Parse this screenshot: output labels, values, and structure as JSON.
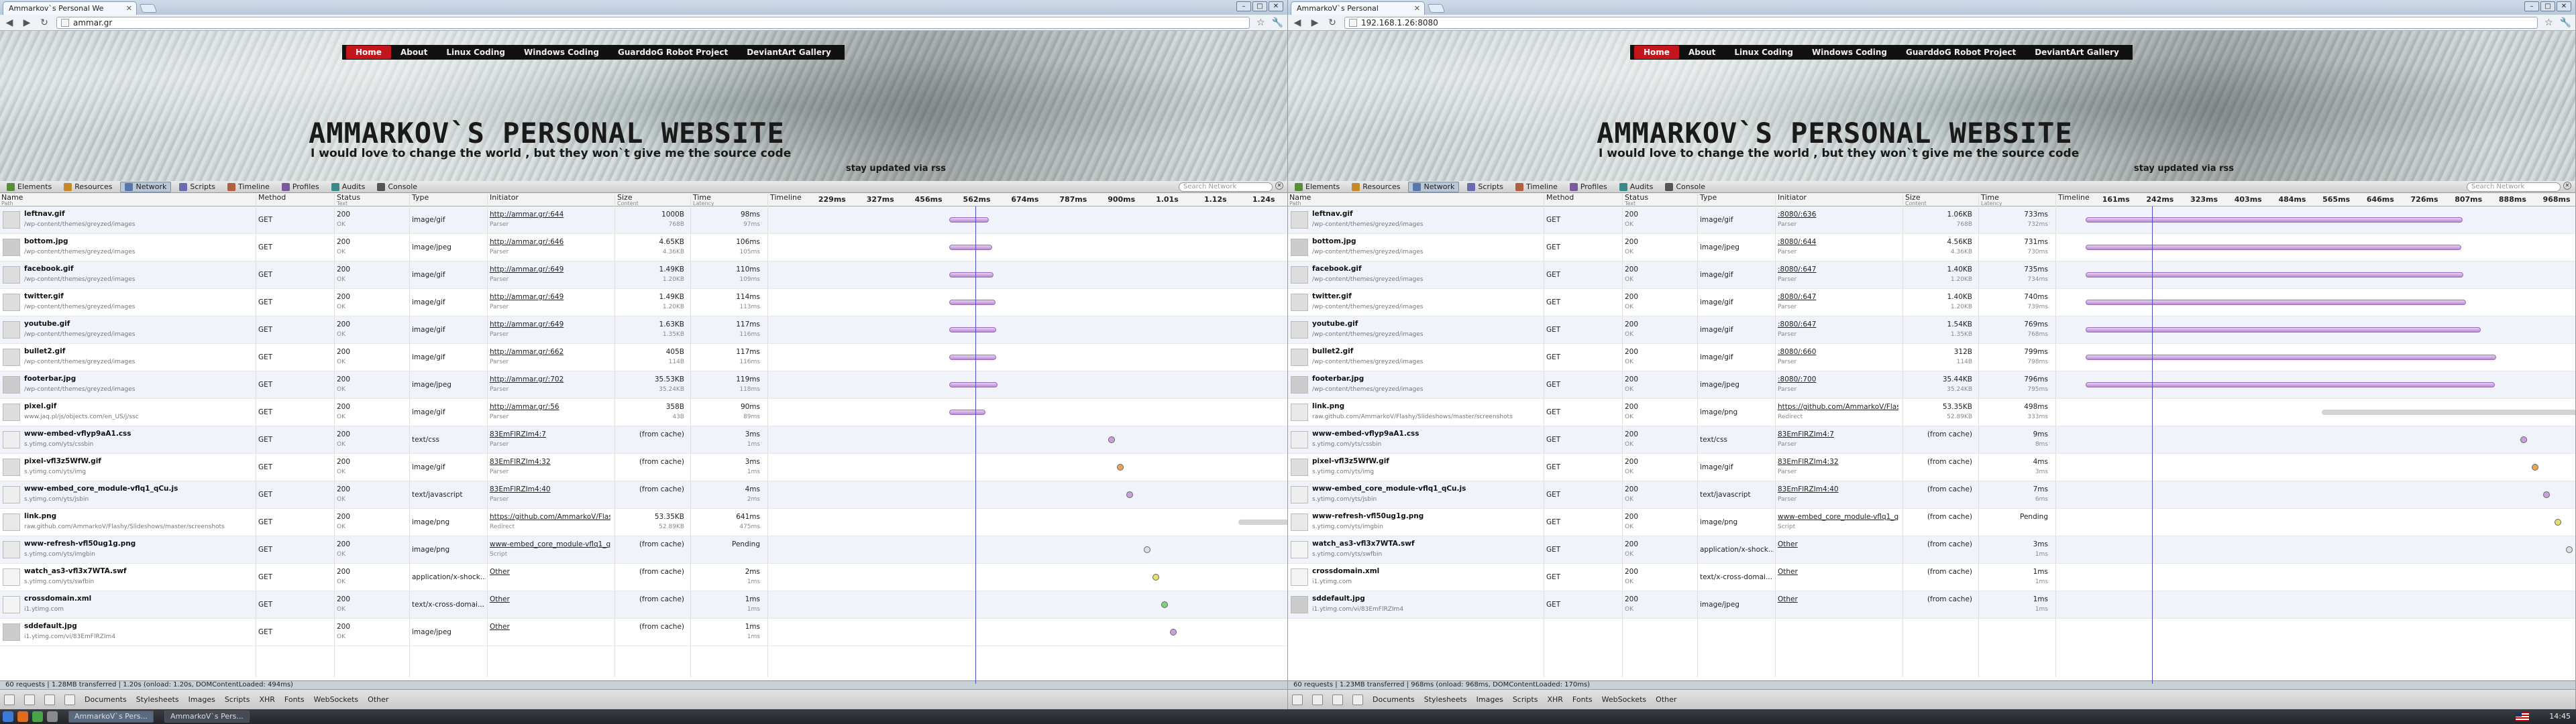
{
  "windows": [
    {
      "tab_title": "Ammarkov`s Personal We",
      "url": "ammar.gr",
      "nav": [
        "Home",
        "About",
        "Linux Coding",
        "Windows Coding",
        "GuarddoG Robot Project",
        "DeviantArt Gallery"
      ],
      "headline": "AMMARKOV`S PERSONAL WEBSITE",
      "tagline": "I would love to change the world , but they won`t give me the source code",
      "stay": "stay updated via rss",
      "timeline_ticks": [
        "229ms",
        "327ms",
        "456ms",
        "562ms",
        "674ms",
        "787ms",
        "900ms",
        "1.01s",
        "1.12s",
        "1.24s"
      ],
      "status": "60 requests  |  1.28MB transferred  |  1.20s (onload: 1.20s, DOMContentLoaded: 494ms)",
      "rows": [
        {
          "name": "leftnav.gif",
          "path": "/wp-content/themes/greyzed/images",
          "method": "GET",
          "status": "200",
          "status_text": "OK",
          "type": "image/gif",
          "init": "http://ammar.gr/:644",
          "init2": "Parser",
          "size": "1000B",
          "content": "768B",
          "time": "98ms",
          "latency": "97ms"
        },
        {
          "name": "bottom.jpg",
          "path": "/wp-content/themes/greyzed/images",
          "method": "GET",
          "status": "200",
          "status_text": "OK",
          "type": "image/jpeg",
          "init": "http://ammar.gr/:646",
          "init2": "Parser",
          "size": "4.65KB",
          "content": "4.36KB",
          "time": "106ms",
          "latency": "105ms"
        },
        {
          "name": "facebook.gif",
          "path": "/wp-content/themes/greyzed/images",
          "method": "GET",
          "status": "200",
          "status_text": "OK",
          "type": "image/gif",
          "init": "http://ammar.gr/:649",
          "init2": "Parser",
          "size": "1.49KB",
          "content": "1.20KB",
          "time": "110ms",
          "latency": "109ms"
        },
        {
          "name": "twitter.gif",
          "path": "/wp-content/themes/greyzed/images",
          "method": "GET",
          "status": "200",
          "status_text": "OK",
          "type": "image/gif",
          "init": "http://ammar.gr/:649",
          "init2": "Parser",
          "size": "1.49KB",
          "content": "1.20KB",
          "time": "114ms",
          "latency": "113ms"
        },
        {
          "name": "youtube.gif",
          "path": "/wp-content/themes/greyzed/images",
          "method": "GET",
          "status": "200",
          "status_text": "OK",
          "type": "image/gif",
          "init": "http://ammar.gr/:649",
          "init2": "Parser",
          "size": "1.63KB",
          "content": "1.35KB",
          "time": "117ms",
          "latency": "116ms"
        },
        {
          "name": "bullet2.gif",
          "path": "/wp-content/themes/greyzed/images",
          "method": "GET",
          "status": "200",
          "status_text": "OK",
          "type": "image/gif",
          "init": "http://ammar.gr/:662",
          "init2": "Parser",
          "size": "405B",
          "content": "114B",
          "time": "117ms",
          "latency": "116ms"
        },
        {
          "name": "footerbar.jpg",
          "path": "/wp-content/themes/greyzed/images",
          "method": "GET",
          "status": "200",
          "status_text": "OK",
          "type": "image/jpeg",
          "init": "http://ammar.gr/:702",
          "init2": "Parser",
          "size": "35.53KB",
          "content": "35.24KB",
          "time": "119ms",
          "latency": "118ms"
        },
        {
          "name": "pixel.gif",
          "path": "www.jaq.pl/js/objects.com/en_US/j/ssc",
          "method": "GET",
          "status": "200",
          "status_text": "OK",
          "type": "image/gif",
          "init": "http://ammar.gr/:56",
          "init2": "Parser",
          "size": "358B",
          "content": "43B",
          "time": "90ms",
          "latency": "89ms"
        },
        {
          "name": "www-embed-vflyp9aA1.css",
          "path": "s.ytimg.com/yts/cssbin",
          "method": "GET",
          "status": "200",
          "status_text": "OK",
          "type": "text/css",
          "init": "83EmFlRZIm4:7",
          "init2": "Parser",
          "size": "(from cache)",
          "content": "",
          "time": "3ms",
          "latency": "1ms"
        },
        {
          "name": "pixel-vfl3z5WfW.gif",
          "path": "s.ytimg.com/yts/img",
          "method": "GET",
          "status": "200",
          "status_text": "OK",
          "type": "image/gif",
          "init": "83EmFlRZIm4:32",
          "init2": "Parser",
          "size": "(from cache)",
          "content": "",
          "time": "3ms",
          "latency": "1ms"
        },
        {
          "name": "www-embed_core_module-vflq1_qCu.js",
          "path": "s.ytimg.com/yts/jsbin",
          "method": "GET",
          "status": "200",
          "status_text": "OK",
          "type": "text/javascript",
          "init": "83EmFlRZIm4:40",
          "init2": "Parser",
          "size": "(from cache)",
          "content": "",
          "time": "4ms",
          "latency": "2ms"
        },
        {
          "name": "link.png",
          "path": "raw.github.com/AmmarkoV/Flashy/Slideshows/master/screenshots",
          "method": "GET",
          "status": "200",
          "status_text": "OK",
          "type": "image/png",
          "init": "https://github.com/AmmarkoV/Flashy/",
          "init2": "Redirect",
          "size": "53.35KB",
          "content": "52.89KB",
          "time": "641ms",
          "latency": "475ms"
        },
        {
          "name": "www-refresh-vfl50ug1g.png",
          "path": "s.ytimg.com/yts/imgbin",
          "method": "GET",
          "status": "200",
          "status_text": "OK",
          "type": "image/png",
          "init": "www-embed_core_module-vflq1_qCu",
          "init2": "Script",
          "size": "(from cache)",
          "content": "",
          "time": "Pending",
          "latency": ""
        },
        {
          "name": "watch_as3-vfl3x7WTA.swf",
          "path": "s.ytimg.com/yts/swfbin",
          "method": "GET",
          "status": "200",
          "status_text": "OK",
          "type": "application/x-shock...",
          "init": "Other",
          "init2": "",
          "size": "(from cache)",
          "content": "",
          "time": "2ms",
          "latency": "1ms"
        },
        {
          "name": "crossdomain.xml",
          "path": "i1.ytimg.com",
          "method": "GET",
          "status": "200",
          "status_text": "OK",
          "type": "text/x-cross-domai...",
          "init": "Other",
          "init2": "",
          "size": "(from cache)",
          "content": "",
          "time": "1ms",
          "latency": "1ms"
        },
        {
          "name": "sddefault.jpg",
          "path": "i1.ytimg.com/vi/83EmFlRZIm4",
          "method": "GET",
          "status": "200",
          "status_text": "OK",
          "type": "image/jpeg",
          "init": "Other",
          "init2": "",
          "size": "(from cache)",
          "content": "",
          "time": "1ms",
          "latency": "1ms"
        }
      ]
    },
    {
      "tab_title": "AmmarkoV`s Personal",
      "url": "192.168.1.26:8080",
      "nav": [
        "Home",
        "About",
        "Linux Coding",
        "Windows Coding",
        "GuarddoG Robot Project",
        "DeviantArt Gallery"
      ],
      "headline": "AMMARKOV`S PERSONAL WEBSITE",
      "tagline": "I would love to change the world , but they won`t give me the source code",
      "stay": "stay updated via rss",
      "timeline_ticks": [
        "161ms",
        "242ms",
        "323ms",
        "403ms",
        "484ms",
        "565ms",
        "646ms",
        "726ms",
        "807ms",
        "888ms",
        "968ms"
      ],
      "status": "60 requests  |  1.23MB transferred  |  968ms (onload: 968ms, DOMContentLoaded: 170ms)",
      "rows": [
        {
          "name": "leftnav.gif",
          "path": "/wp-content/themes/greyzed/images",
          "method": "GET",
          "status": "200",
          "status_text": "OK",
          "type": "image/gif",
          "init": ":8080/:636",
          "init2": "Parser",
          "size": "1.06KB",
          "content": "768B",
          "time": "733ms",
          "latency": "732ms"
        },
        {
          "name": "bottom.jpg",
          "path": "/wp-content/themes/greyzed/images",
          "method": "GET",
          "status": "200",
          "status_text": "OK",
          "type": "image/jpeg",
          "init": ":8080/:644",
          "init2": "Parser",
          "size": "4.56KB",
          "content": "4.36KB",
          "time": "731ms",
          "latency": "730ms"
        },
        {
          "name": "facebook.gif",
          "path": "/wp-content/themes/greyzed/images",
          "method": "GET",
          "status": "200",
          "status_text": "OK",
          "type": "image/gif",
          "init": ":8080/:647",
          "init2": "Parser",
          "size": "1.40KB",
          "content": "1.20KB",
          "time": "735ms",
          "latency": "734ms"
        },
        {
          "name": "twitter.gif",
          "path": "/wp-content/themes/greyzed/images",
          "method": "GET",
          "status": "200",
          "status_text": "OK",
          "type": "image/gif",
          "init": ":8080/:647",
          "init2": "Parser",
          "size": "1.40KB",
          "content": "1.20KB",
          "time": "740ms",
          "latency": "739ms"
        },
        {
          "name": "youtube.gif",
          "path": "/wp-content/themes/greyzed/images",
          "method": "GET",
          "status": "200",
          "status_text": "OK",
          "type": "image/gif",
          "init": ":8080/:647",
          "init2": "Parser",
          "size": "1.54KB",
          "content": "1.35KB",
          "time": "769ms",
          "latency": "768ms"
        },
        {
          "name": "bullet2.gif",
          "path": "/wp-content/themes/greyzed/images",
          "method": "GET",
          "status": "200",
          "status_text": "OK",
          "type": "image/gif",
          "init": ":8080/:660",
          "init2": "Parser",
          "size": "312B",
          "content": "114B",
          "time": "799ms",
          "latency": "798ms"
        },
        {
          "name": "footerbar.jpg",
          "path": "/wp-content/themes/greyzed/images",
          "method": "GET",
          "status": "200",
          "status_text": "OK",
          "type": "image/jpeg",
          "init": ":8080/:700",
          "init2": "Parser",
          "size": "35.44KB",
          "content": "35.24KB",
          "time": "796ms",
          "latency": "795ms"
        },
        {
          "name": "link.png",
          "path": "raw.github.com/AmmarkoV/Flashy/Slideshows/master/screenshots",
          "method": "GET",
          "status": "200",
          "status_text": "OK",
          "type": "image/png",
          "init": "https://github.com/AmmarkoV/Flashy/",
          "init2": "Redirect",
          "size": "53.35KB",
          "content": "52.89KB",
          "time": "498ms",
          "latency": "333ms"
        },
        {
          "name": "www-embed-vflyp9aA1.css",
          "path": "s.ytimg.com/yts/cssbin",
          "method": "GET",
          "status": "200",
          "status_text": "OK",
          "type": "text/css",
          "init": "83EmFlRZIm4:7",
          "init2": "Parser",
          "size": "(from cache)",
          "content": "",
          "time": "9ms",
          "latency": "8ms"
        },
        {
          "name": "pixel-vfl3z5WfW.gif",
          "path": "s.ytimg.com/yts/img",
          "method": "GET",
          "status": "200",
          "status_text": "OK",
          "type": "image/gif",
          "init": "83EmFlRZIm4:32",
          "init2": "Parser",
          "size": "(from cache)",
          "content": "",
          "time": "4ms",
          "latency": "3ms"
        },
        {
          "name": "www-embed_core_module-vflq1_qCu.js",
          "path": "s.ytimg.com/yts/jsbin",
          "method": "GET",
          "status": "200",
          "status_text": "OK",
          "type": "text/javascript",
          "init": "83EmFlRZIm4:40",
          "init2": "Parser",
          "size": "(from cache)",
          "content": "",
          "time": "7ms",
          "latency": "6ms"
        },
        {
          "name": "www-refresh-vfl50ug1g.png",
          "path": "s.ytimg.com/yts/imgbin",
          "method": "GET",
          "status": "200",
          "status_text": "OK",
          "type": "image/png",
          "init": "www-embed_core_module-vflq1_qCu",
          "init2": "Script",
          "size": "(from cache)",
          "content": "",
          "time": "Pending",
          "latency": ""
        },
        {
          "name": "watch_as3-vfl3x7WTA.swf",
          "path": "s.ytimg.com/yts/swfbin",
          "method": "GET",
          "status": "200",
          "status_text": "OK",
          "type": "application/x-shock...",
          "init": "Other",
          "init2": "",
          "size": "(from cache)",
          "content": "",
          "time": "3ms",
          "latency": "1ms"
        },
        {
          "name": "crossdomain.xml",
          "path": "i1.ytimg.com",
          "method": "GET",
          "status": "200",
          "status_text": "OK",
          "type": "text/x-cross-domai...",
          "init": "Other",
          "init2": "",
          "size": "(from cache)",
          "content": "",
          "time": "1ms",
          "latency": "1ms"
        },
        {
          "name": "sddefault.jpg",
          "path": "i1.ytimg.com/vi/83EmFlRZIm4",
          "method": "GET",
          "status": "200",
          "status_text": "OK",
          "type": "image/jpeg",
          "init": "Other",
          "init2": "",
          "size": "(from cache)",
          "content": "",
          "time": "1ms",
          "latency": "1ms"
        }
      ]
    }
  ],
  "devtools_tabs": [
    "Elements",
    "Resources",
    "Network",
    "Scripts",
    "Timeline",
    "Profiles",
    "Audits",
    "Console"
  ],
  "search_placeholder": "Search Network",
  "columns": {
    "name": "Name",
    "path": "Path",
    "method": "Method",
    "status": "Status",
    "status_text": "Text",
    "type": "Type",
    "initiator": "Initiator",
    "size": "Size",
    "content": "Content",
    "time": "Time",
    "latency": "Latency",
    "timeline": "Timeline"
  },
  "filters": [
    "Documents",
    "Stylesheets",
    "Images",
    "Scripts",
    "XHR",
    "Fonts",
    "WebSockets",
    "Other"
  ],
  "taskbar": {
    "task1": "AmmarkoV`s Pers...",
    "task2": "AmmarkoV`s Pers...",
    "clock": "14:45"
  },
  "accent": "#c3161c"
}
